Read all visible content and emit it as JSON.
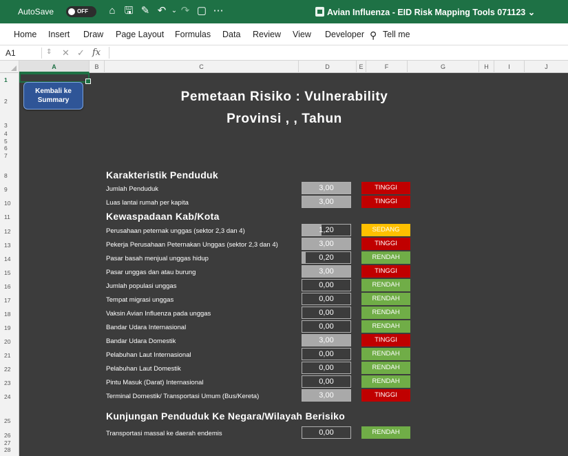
{
  "titlebar": {
    "autosave_label": "AutoSave",
    "autosave_state": "OFF",
    "doc_title": "Avian Influenza - EID Risk Mapping Tools 071123 ⌄",
    "quick_icons": [
      "⌂",
      "🖫",
      "✎",
      "↶",
      "⌄",
      "↷",
      "▢",
      "⋯"
    ],
    "accent_color": "#1e7145"
  },
  "ribbon": {
    "tabs": [
      "Home",
      "Insert",
      "Draw",
      "Page Layout",
      "Formulas",
      "Data",
      "Review",
      "View",
      "Developer"
    ],
    "tell_me": "Tell me"
  },
  "formula_bar": {
    "cell_ref": "A1",
    "fx": "fx"
  },
  "columns": [
    "A",
    "B",
    "C",
    "D",
    "E",
    "F",
    "G",
    "H",
    "I",
    "J"
  ],
  "rows": [
    "1",
    "2",
    "3",
    "4",
    "5",
    "6",
    "7",
    "8",
    "9",
    "10",
    "11",
    "12",
    "13",
    "14",
    "15",
    "16",
    "17",
    "18",
    "19",
    "20",
    "21",
    "22",
    "23",
    "24",
    "25",
    "26",
    "27",
    "28"
  ],
  "sheet": {
    "back_button": "Kembali ke Summary",
    "title_line1": "Pemetaan Risiko : Vulnerability",
    "title_line2": "Provinsi , , Tahun",
    "sections": {
      "penduduk": "Karakteristik Penduduk",
      "kewaspadaan": "Kewaspadaan Kab/Kota",
      "kunjungan": "Kunjungan Penduduk Ke Negara/Wilayah Berisiko"
    },
    "items": [
      {
        "label": "Jumlah Penduduk",
        "value": "3,00",
        "fill": 1.0,
        "status": "TINGGI",
        "color": "#c00000"
      },
      {
        "label": "Luas lantai rumah per kapita",
        "value": "3,00",
        "fill": 1.0,
        "status": "TINGGI",
        "color": "#c00000"
      },
      {
        "label": "Perusahaan peternak unggas (sektor 2,3 dan 4)",
        "value": "1,20",
        "fill": 0.4,
        "status": "SEDANG",
        "color": "#ffc000"
      },
      {
        "label": "Pekerja Perusahaan Peternakan Unggas (sektor 2,3 dan 4)",
        "value": "3,00",
        "fill": 1.0,
        "status": "TINGGI",
        "color": "#c00000"
      },
      {
        "label": "Pasar basah menjual unggas hidup",
        "value": "0,20",
        "fill": 0.067,
        "status": "RENDAH",
        "color": "#70ad47"
      },
      {
        "label": "Pasar unggas dan atau burung",
        "value": "3,00",
        "fill": 1.0,
        "status": "TINGGI",
        "color": "#c00000"
      },
      {
        "label": "Jumlah populasi unggas",
        "value": "0,00",
        "fill": 0,
        "status": "RENDAH",
        "color": "#70ad47"
      },
      {
        "label": "Tempat migrasi unggas",
        "value": "0,00",
        "fill": 0,
        "status": "RENDAH",
        "color": "#70ad47"
      },
      {
        "label": "Vaksin Avian Influenza pada unggas",
        "value": "0,00",
        "fill": 0,
        "status": "RENDAH",
        "color": "#70ad47"
      },
      {
        "label": "Bandar Udara Internasional",
        "value": "0,00",
        "fill": 0,
        "status": "RENDAH",
        "color": "#70ad47"
      },
      {
        "label": "Bandar Udara Domestik",
        "value": "3,00",
        "fill": 1.0,
        "status": "TINGGI",
        "color": "#c00000"
      },
      {
        "label": "Pelabuhan Laut Internasional",
        "value": "0,00",
        "fill": 0,
        "status": "RENDAH",
        "color": "#70ad47"
      },
      {
        "label": "Pelabuhan Laut Domestik",
        "value": "0,00",
        "fill": 0,
        "status": "RENDAH",
        "color": "#70ad47"
      },
      {
        "label": "Pintu Masuk (Darat) Internasional",
        "value": "0,00",
        "fill": 0,
        "status": "RENDAH",
        "color": "#70ad47"
      },
      {
        "label": "Terminal Domestik/ Transportasi Umum (Bus/Kereta)",
        "value": "3,00",
        "fill": 1.0,
        "status": "TINGGI",
        "color": "#c00000"
      },
      {
        "label": "Transportasi massal ke daerah endemis",
        "value": "0,00",
        "fill": 0,
        "status": "RENDAH",
        "color": "#70ad47"
      }
    ]
  }
}
